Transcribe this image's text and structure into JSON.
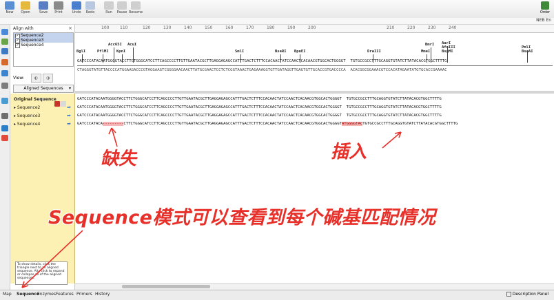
{
  "toolbar": {
    "buttons": [
      {
        "label": "New",
        "icon": "new-icon",
        "color": "#5a8fd6"
      },
      {
        "label": "Open",
        "icon": "open-folder-icon",
        "color": "#e6b83c"
      },
      {
        "label": "Save",
        "icon": "save-icon",
        "color": "#5a7ec4"
      },
      {
        "label": "Print",
        "icon": "print-icon",
        "color": "#8a8a8a"
      },
      {
        "label": "Undo",
        "icon": "undo-icon",
        "color": "#4a7fd0"
      },
      {
        "label": "Redo",
        "icon": "redo-icon",
        "color": "#b8c8e0"
      },
      {
        "label": "Run",
        "icon": "run-icon",
        "color": "#cfcfcf"
      },
      {
        "label": "Pause",
        "icon": "pause-icon",
        "color": "#cfcfcf"
      },
      {
        "label": "Resume",
        "icon": "resume-icon",
        "color": "#cfcfcf"
      }
    ],
    "right_label": "Order"
  },
  "subbar": {
    "right_text": "NEB En"
  },
  "left_panel": {
    "title": "Align with",
    "close": "×",
    "items": [
      "Sequence2",
      "Sequence3",
      "Sequence4"
    ],
    "view_label": "View:",
    "select_value": "Aligned Sequences"
  },
  "map": {
    "ruler_ticks": [
      "100",
      "110",
      "120",
      "130",
      "140",
      "150",
      "160",
      "170",
      "180",
      "190",
      "200",
      "210",
      "220",
      "230",
      "240"
    ],
    "enzymes": [
      "BsaAI",
      "PmlI",
      "BsgMI",
      "AfeIII",
      "AarI",
      "BmrI",
      "MmeI",
      "DraIII",
      "BpuEI",
      "BseRI",
      "SmlI",
      "KpnI",
      "AcuI",
      "Acc65I",
      "PflMI",
      "BglI"
    ],
    "top_strand": "GATCCCATACAATGGGGTACCTTCTGGGCATCCTTCAGCCCCTTGTTGAATACGCTTGAGGAGAGCCATTTGACTCTTTCCACAACTATCCAACTCACAACGTGGCACTGGGGT  TGTGCCGCCTTTGCAGGTGTATCTTATACACGTGGCTTTTG",
    "bottom_strand": "CTAGGGTATGTTACCCCATGGAAGACCCGTAGGAAGTCGGGGAACAACTTATGCGAACTCCTCTCGGTAAACTGAGAAAGGTGTTGATAGGTTGAGTGTTGCACCGTGACCCCA  ACACGGCGGAAACGTCCACATAGAATATGTGCACCGAAAAC"
  },
  "alignment": {
    "original_label": "Original Sequence",
    "rows": [
      {
        "name": "Original Sequence",
        "seq_a": "GATCCCATACAATGGGGTACCTTCTGGGCATCCTTCAGCCCCTTGTTGAATACGCTTGAGGAGAGCCATTTGACTCTTTCCACAACTATCCAACTCACAACGTGGCACTGGGGT",
        "seq_b": "",
        "seq_c": "  TGTGCCGCCTTTGCAGGTGTATCTTATACACGTGGCTTTTG"
      },
      {
        "name": "Sequence2",
        "seq_a": "GATCCCATACAATGGGGTACCTTCTGGGCATCCTTCAGCCCCTTGTTGAATACGCTTGAGGAGAGCCATTTGACTCTTTCCACAACTATCCAACTCACAACGTGGCACTGGGGT",
        "seq_b": "",
        "seq_c": "  TGTGCCGCCTTTGCAGGTGTATCTTATACACGTGGCTTTTG"
      },
      {
        "name": "Sequence3",
        "seq_a": "GATCCCATACAATGGGGTACCTTCTGGGCATCCTTCAGCCCCTTGTTGAATACGCTTGAGGAGAGCCATTTGACTCTTTCCACAACTATCCAACTCACAACGTGGCACTGGGGT",
        "seq_b": "",
        "seq_c": "  TGTGCCGCCTTTGCAGGTGTATCTTATACACGTGGCTTTTG"
      },
      {
        "name": "Sequence4",
        "seq_a": "GATCCCATACA",
        "seq_gap": "---------",
        "seq_b": "CTTCTGGGCATCCTTCAGCCCCTTGTTGAATACGCTTGAGGAGAGCCATTTGACTCTTTCCACAACTATCCAACTCACAACGTGGCACTGGGGT",
        "seq_ins": "ATGGGGTAC",
        "seq_c": "TGTGCCGCCTTTGCAGGTGTATCTTATACACGTGGCTTTTG"
      }
    ]
  },
  "tip_text": "To show details, click the triangle next to an aligned sequence. Alt+click to expand or collapse all of the aligned sequences.",
  "tabs": [
    "Map",
    "Sequence",
    "Enzymes",
    "Features",
    "Primers",
    "History"
  ],
  "active_tab": "Sequence",
  "description_panel_label": "Description Panel",
  "annotations": {
    "deletion": "缺失",
    "insertion": "插入",
    "caption": "Sequence模式可以查看到每个碱基匹配情况"
  },
  "colors": {
    "annotation": "#e8302a",
    "highlight": "#f4b6b6",
    "names_bg": "#fdf0b3"
  }
}
